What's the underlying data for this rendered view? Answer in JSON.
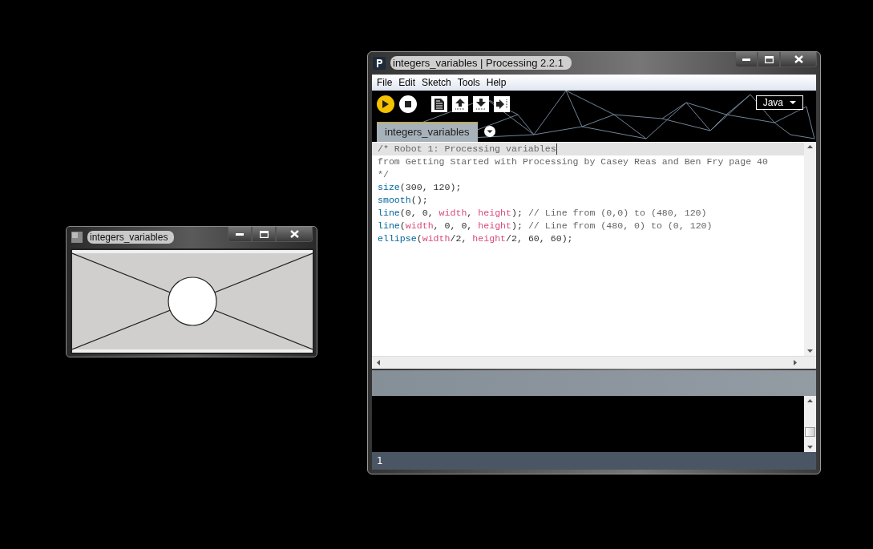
{
  "sketch_window": {
    "title": "integers_variables"
  },
  "editor_window": {
    "title": "integers_variables | Processing 2.2.1",
    "menu": [
      "File",
      "Edit",
      "Sketch",
      "Tools",
      "Help"
    ],
    "mode": "Java",
    "tabs": [
      {
        "label": "integers_variables",
        "selected": true
      }
    ],
    "code_lines": [
      {
        "selected": true,
        "tokens": [
          {
            "kind": "comment",
            "text": "/* Robot 1: Processing variables"
          }
        ]
      },
      {
        "selected": false,
        "tokens": [
          {
            "kind": "comment",
            "text": "from Getting Started with Processing by Casey Reas and Ben Fry page 40"
          }
        ]
      },
      {
        "selected": false,
        "tokens": [
          {
            "kind": "comment",
            "text": "*/"
          }
        ]
      },
      {
        "selected": false,
        "tokens": [
          {
            "kind": "function",
            "text": "size"
          },
          {
            "kind": "plain",
            "text": "(300, 120);"
          }
        ]
      },
      {
        "selected": false,
        "tokens": [
          {
            "kind": "function",
            "text": "smooth"
          },
          {
            "kind": "plain",
            "text": "();"
          }
        ]
      },
      {
        "selected": false,
        "tokens": [
          {
            "kind": "function",
            "text": "line"
          },
          {
            "kind": "plain",
            "text": "(0, 0, "
          },
          {
            "kind": "variable",
            "text": "width"
          },
          {
            "kind": "plain",
            "text": ", "
          },
          {
            "kind": "variable",
            "text": "height"
          },
          {
            "kind": "plain",
            "text": "); "
          },
          {
            "kind": "comment",
            "text": "// Line from (0,0) to (480, 120)"
          }
        ]
      },
      {
        "selected": false,
        "tokens": [
          {
            "kind": "function",
            "text": "line"
          },
          {
            "kind": "plain",
            "text": "("
          },
          {
            "kind": "variable",
            "text": "width"
          },
          {
            "kind": "plain",
            "text": ", 0, 0, "
          },
          {
            "kind": "variable",
            "text": "height"
          },
          {
            "kind": "plain",
            "text": "); "
          },
          {
            "kind": "comment",
            "text": "// Line from (480, 0) to (0, 120)"
          }
        ]
      },
      {
        "selected": false,
        "tokens": [
          {
            "kind": "function",
            "text": "ellipse"
          },
          {
            "kind": "plain",
            "text": "("
          },
          {
            "kind": "variable",
            "text": "width"
          },
          {
            "kind": "plain",
            "text": "/2, "
          },
          {
            "kind": "variable",
            "text": "height"
          },
          {
            "kind": "plain",
            "text": "/2, 60, 60);"
          }
        ]
      }
    ],
    "status_line": "1"
  }
}
